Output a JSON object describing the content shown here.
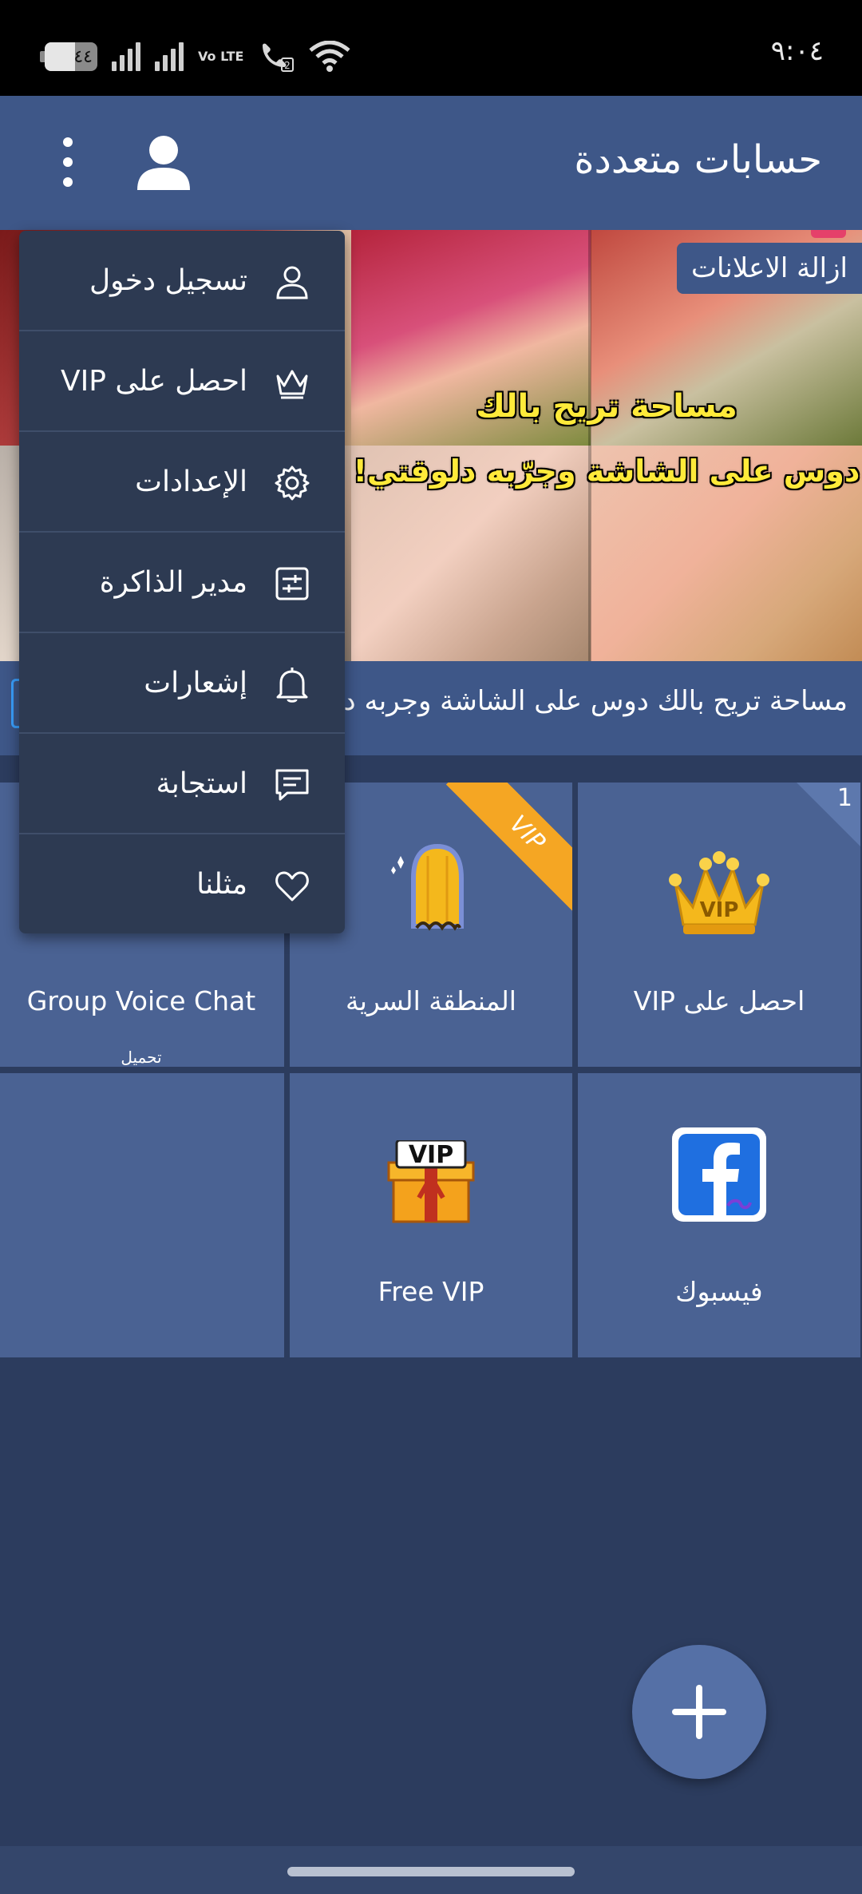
{
  "status_bar": {
    "battery_level": "٤٤",
    "network_label": "Vo LTE",
    "sim_label": "2",
    "time": "٩:٠٤"
  },
  "app_bar": {
    "title": "حسابات متعددة",
    "user_icon": "user-icon",
    "more_icon": "more-vert-icon"
  },
  "ad_banner": {
    "remove_ads_label": "ازالة الاعلانات",
    "headline_line1": "مساحة تريح بالك",
    "headline_line2": "دوس على الشاشة وجرّبه دلوقتي!",
    "caption": "مساحة تريح بالك دوس على الشاشة وجربه دلوقتي!"
  },
  "grid": {
    "tiles": [
      {
        "label": "احصل على VIP",
        "badge": "1",
        "icon": "vip-crown-icon"
      },
      {
        "label": "المنطقة السرية",
        "ribbon": "VIP",
        "icon": "secret-door-icon"
      },
      {
        "label": "Group Voice Chat",
        "sub": "تحميل",
        "icon": "group-voice-chat-icon"
      },
      {
        "label": "فيسبوك",
        "icon": "facebook-clone-icon"
      },
      {
        "label": "Free VIP",
        "icon": "vip-gift-icon"
      },
      {
        "label": "",
        "icon": ""
      }
    ]
  },
  "menu": {
    "items": [
      {
        "label": "تسجيل دخول",
        "icon": "user-icon"
      },
      {
        "label": "احصل على VIP",
        "icon": "crown-icon"
      },
      {
        "label": "الإعدادات",
        "icon": "gear-icon"
      },
      {
        "label": "مدير الذاكرة",
        "icon": "memory-manager-icon"
      },
      {
        "label": "إشعارات",
        "icon": "bell-icon"
      },
      {
        "label": "استجابة",
        "icon": "feedback-icon"
      },
      {
        "label": "مثلنا",
        "icon": "heart-icon"
      }
    ]
  },
  "fab": {
    "icon": "plus-icon"
  },
  "colors": {
    "background": "#2c3c5e",
    "app_bar": "#3e5788",
    "tile": "#4a6293",
    "menu": "#2d3a52",
    "vip_orange": "#f5a623",
    "headline_yellow": "#ffea3a"
  }
}
